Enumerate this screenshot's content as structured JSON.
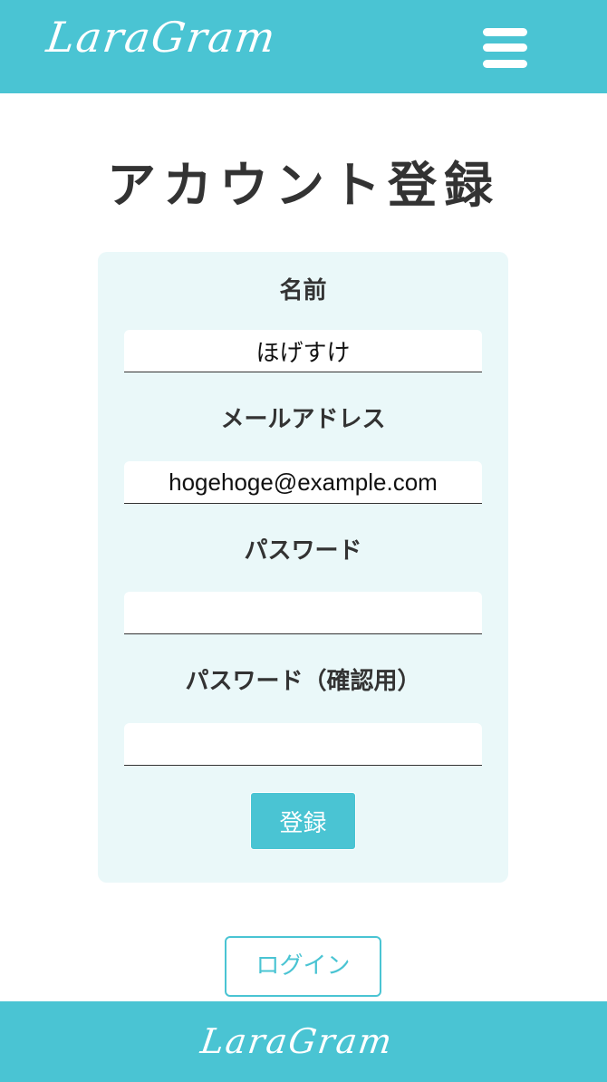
{
  "brand": {
    "logo_text": "LaraGram",
    "color": "#4ac4d3"
  },
  "header": {
    "menu_icon": "hamburger-menu-icon"
  },
  "page": {
    "title": "アカウント登録"
  },
  "form": {
    "name_label": "名前",
    "name_value": "ほげすけ",
    "email_label": "メールアドレス",
    "email_value": "hogehoge@example.com",
    "password_label": "パスワード",
    "password_value": "",
    "password_confirm_label": "パスワード（確認用）",
    "password_confirm_value": "",
    "submit_label": "登録"
  },
  "links": {
    "login_label": "ログイン"
  },
  "footer": {
    "logo_text": "LaraGram"
  }
}
